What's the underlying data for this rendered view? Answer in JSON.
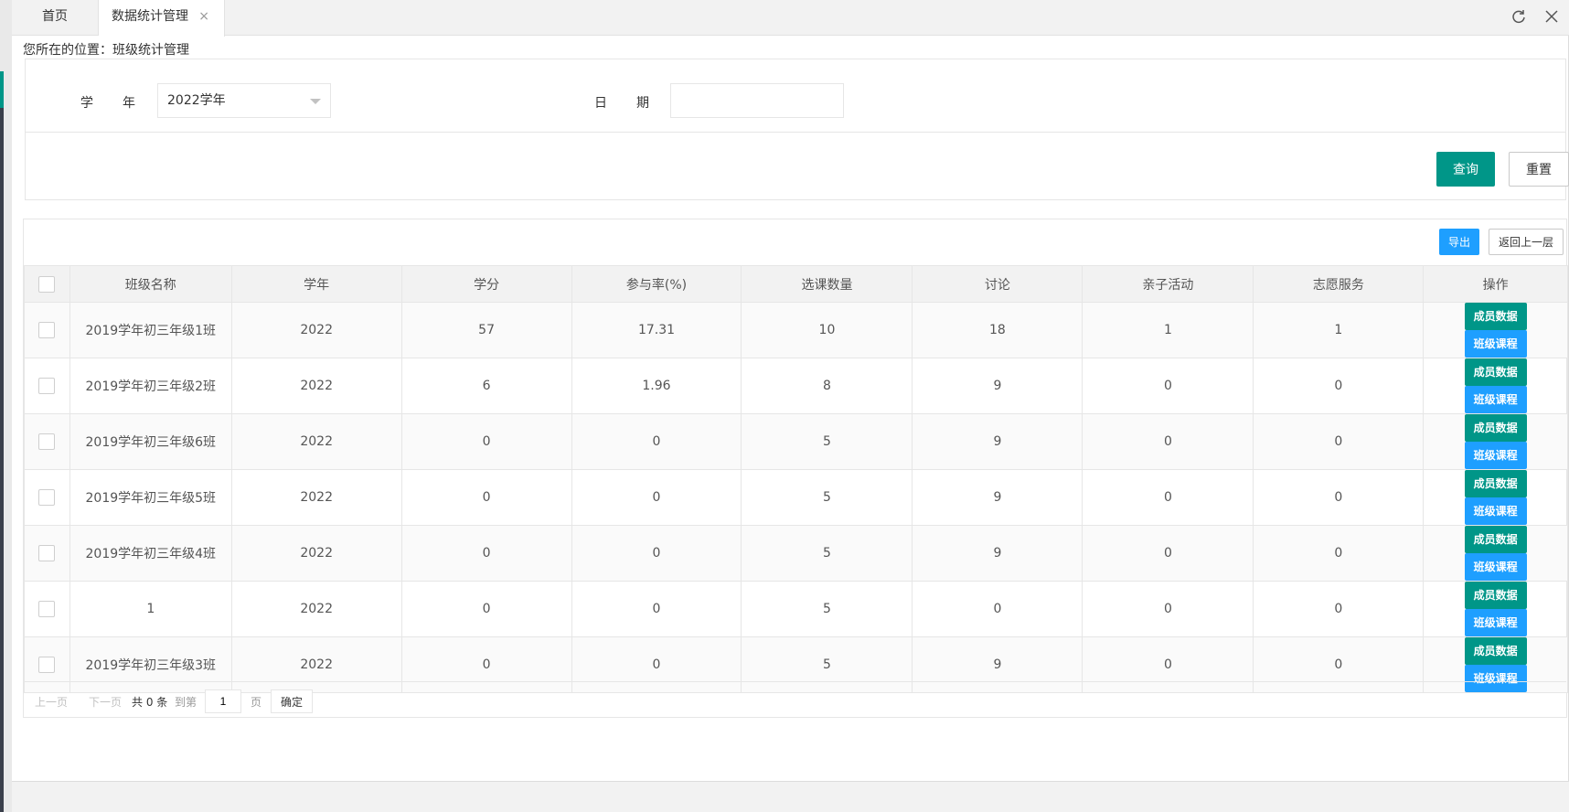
{
  "tabs": {
    "home": "首页",
    "active": "数据统计管理",
    "close_glyph": "×"
  },
  "breadcrumb": "您所在的位置：班级统计管理",
  "filters": {
    "year_label_1": "学",
    "year_label_2": "年",
    "year_value": "2022学年",
    "date_label_1": "日",
    "date_label_2": "期",
    "date_value": "",
    "query_button": "查询",
    "reset_button": "重置"
  },
  "toolbar": {
    "export_button": "导出",
    "back_button": "返回上一层"
  },
  "table": {
    "headers": [
      "班级名称",
      "学年",
      "学分",
      "参与率(%)",
      "选课数量",
      "讨论",
      "亲子活动",
      "志愿服务",
      "操作"
    ],
    "member_button": "成员数据",
    "course_button": "班级课程",
    "rows": [
      [
        "2019学年初三年级1班",
        "2022",
        "57",
        "17.31",
        "10",
        "18",
        "1",
        "1"
      ],
      [
        "2019学年初三年级2班",
        "2022",
        "6",
        "1.96",
        "8",
        "9",
        "0",
        "0"
      ],
      [
        "2019学年初三年级6班",
        "2022",
        "0",
        "0",
        "5",
        "9",
        "0",
        "0"
      ],
      [
        "2019学年初三年级5班",
        "2022",
        "0",
        "0",
        "5",
        "9",
        "0",
        "0"
      ],
      [
        "2019学年初三年级4班",
        "2022",
        "0",
        "0",
        "5",
        "9",
        "0",
        "0"
      ],
      [
        "1",
        "2022",
        "0",
        "0",
        "5",
        "0",
        "0",
        "0"
      ],
      [
        "2019学年初三年级3班",
        "2022",
        "0",
        "0",
        "5",
        "9",
        "0",
        "0"
      ]
    ]
  },
  "pager": {
    "prev": "上一页",
    "next": "下一页",
    "total": "共 0 条",
    "goto": "到第",
    "page_value": "1",
    "unit": "页",
    "confirm": "确定"
  }
}
